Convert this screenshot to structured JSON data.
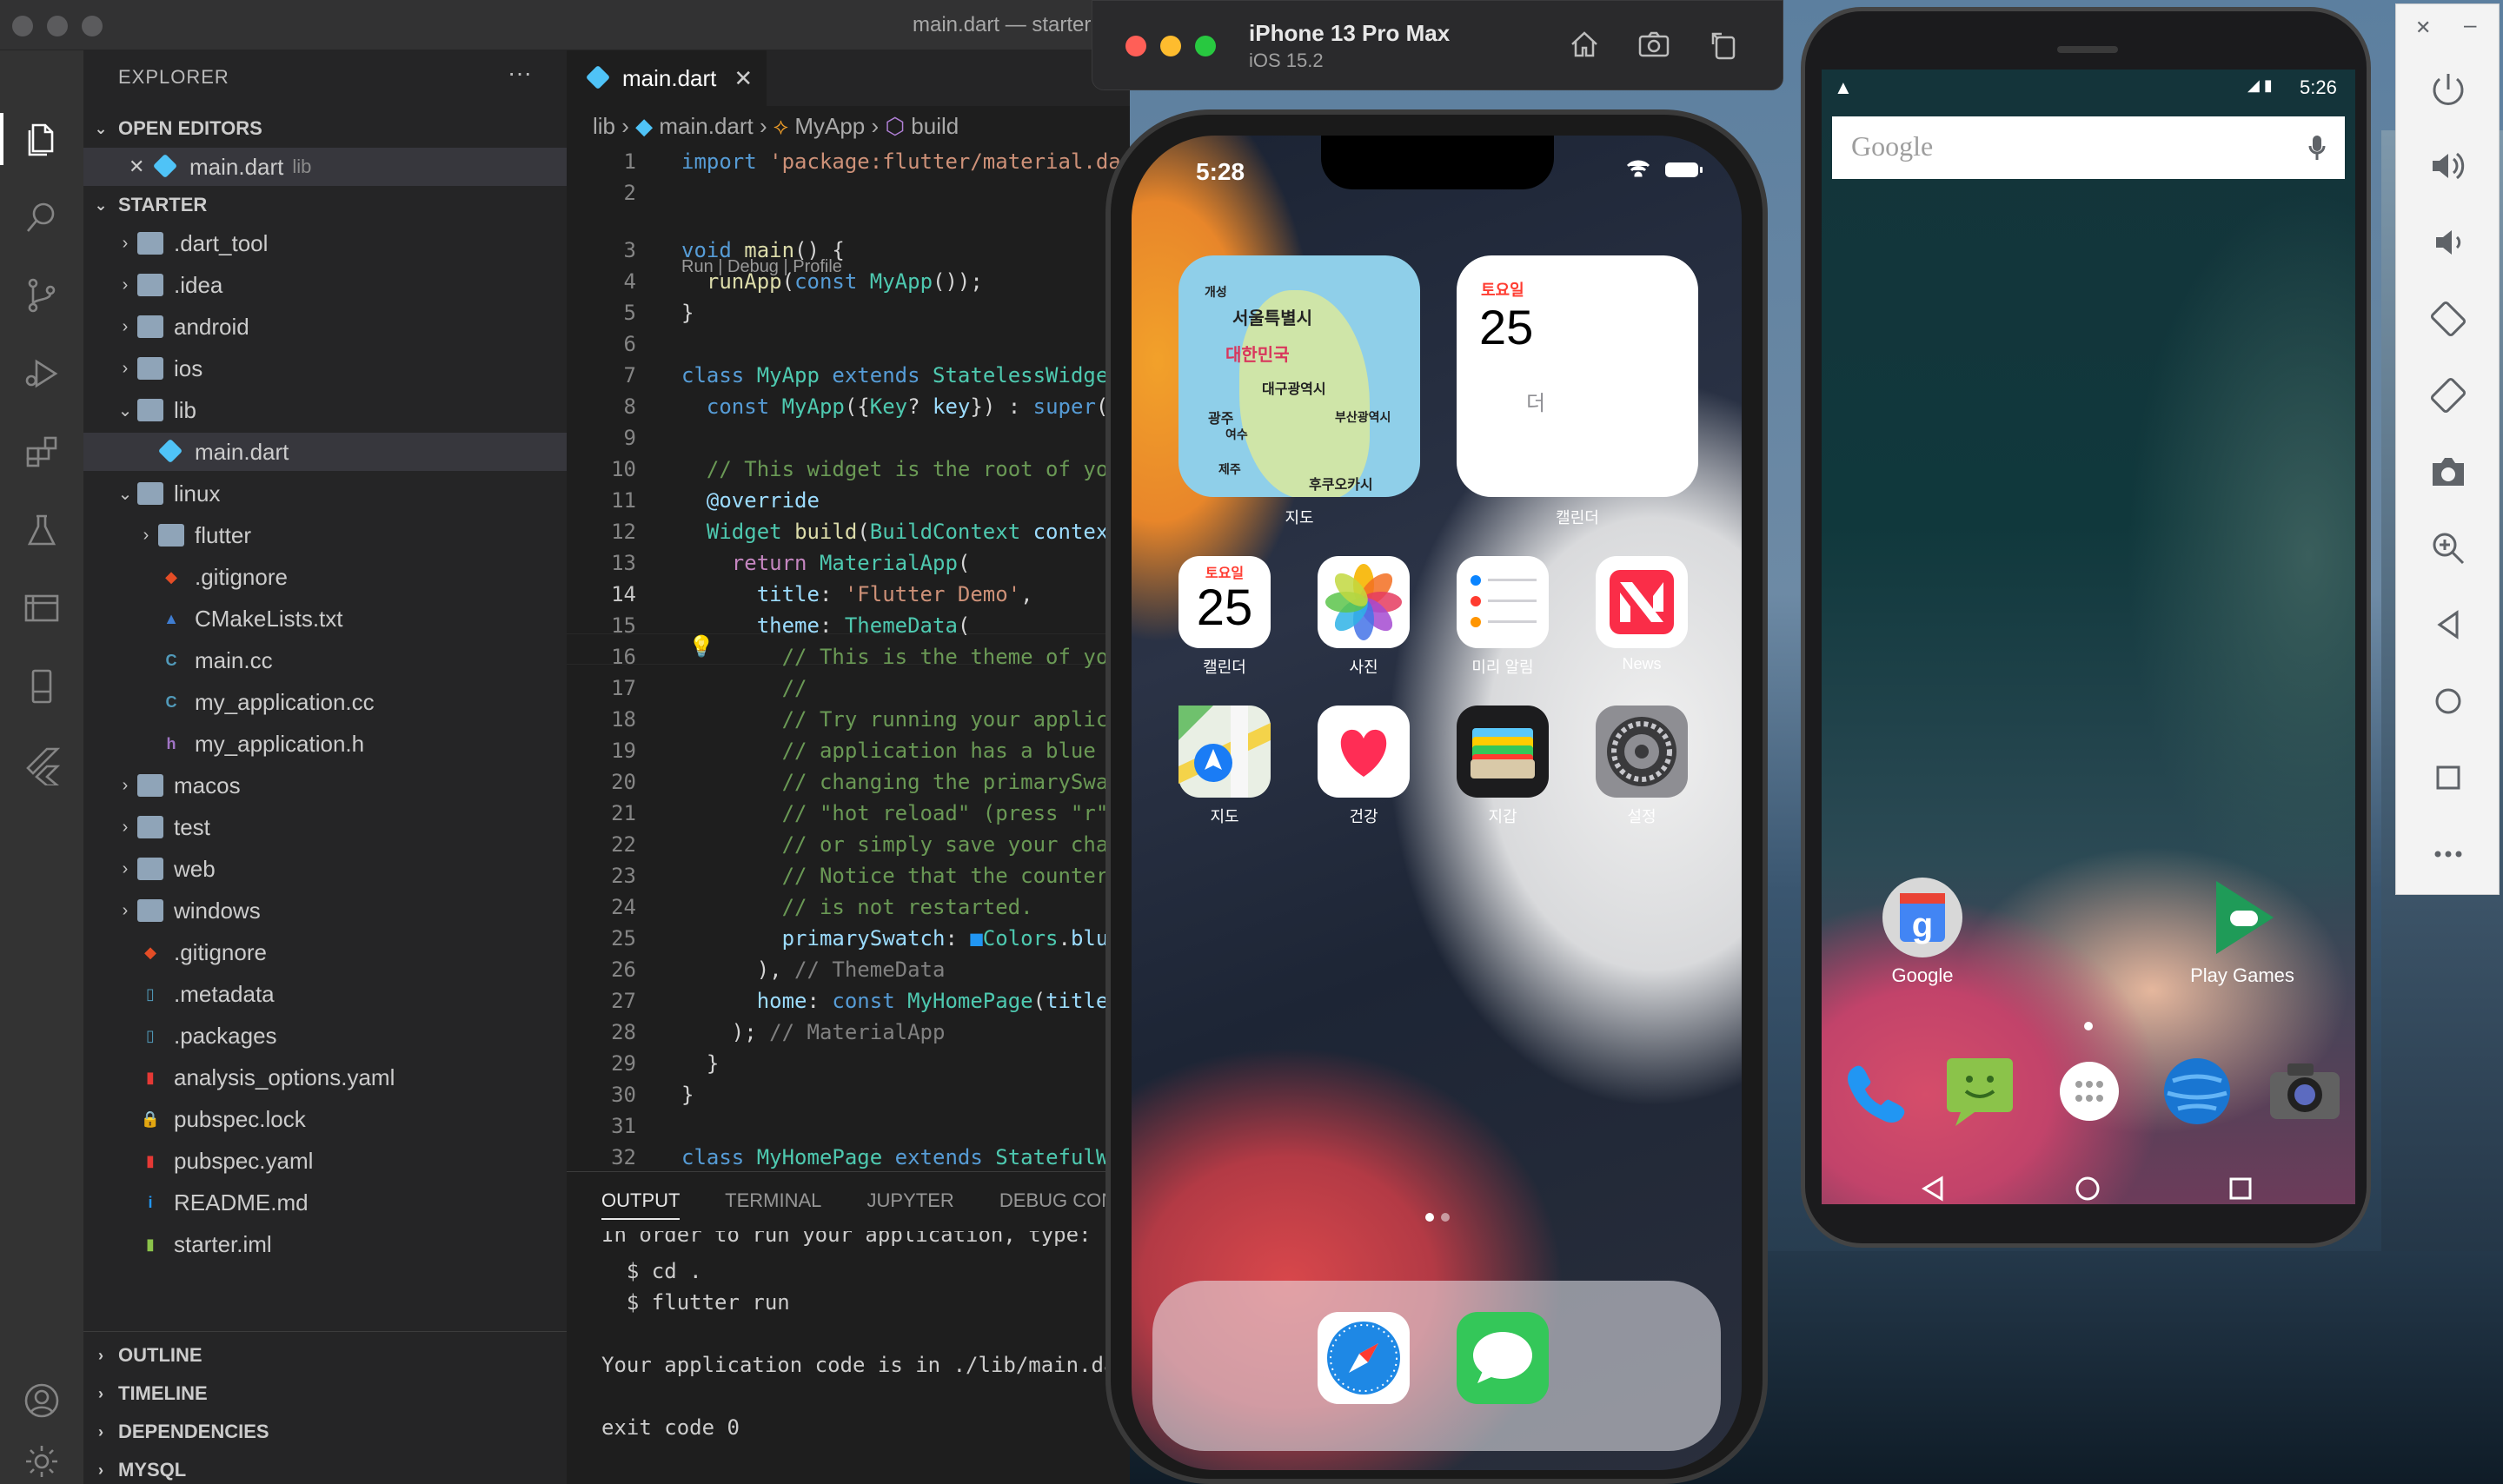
{
  "vscode": {
    "window_title": "main.dart — starter",
    "explorer_title": "EXPLORER",
    "more": "···",
    "open_editors_label": "OPEN EDITORS",
    "open_editor": {
      "name": "main.dart",
      "dir": "lib"
    },
    "project_label": "STARTER",
    "tree": [
      {
        "name": ".dart_tool",
        "kind": "folder",
        "chev": "›"
      },
      {
        "name": ".idea",
        "kind": "folder",
        "chev": "›"
      },
      {
        "name": "android",
        "kind": "folder",
        "chev": "›"
      },
      {
        "name": "ios",
        "kind": "folder",
        "chev": "›"
      },
      {
        "name": "lib",
        "kind": "folder",
        "chev": "⌄"
      },
      {
        "name": "main.dart",
        "kind": "dart"
      },
      {
        "name": "linux",
        "kind": "folder",
        "chev": "⌄"
      },
      {
        "name": "flutter",
        "kind": "folder",
        "chev": "›"
      },
      {
        "name": ".gitignore",
        "kind": "git"
      },
      {
        "name": "CMakeLists.txt",
        "kind": "cmake"
      },
      {
        "name": "main.cc",
        "kind": "cpp"
      },
      {
        "name": "my_application.cc",
        "kind": "cpp"
      },
      {
        "name": "my_application.h",
        "kind": "h"
      },
      {
        "name": "macos",
        "kind": "folder",
        "chev": "›"
      },
      {
        "name": "test",
        "kind": "folder",
        "chev": "›"
      },
      {
        "name": "web",
        "kind": "folder",
        "chev": "›"
      },
      {
        "name": "windows",
        "kind": "folder",
        "chev": "›"
      },
      {
        "name": ".gitignore",
        "kind": "git"
      },
      {
        "name": ".metadata",
        "kind": "file"
      },
      {
        "name": ".packages",
        "kind": "file"
      },
      {
        "name": "analysis_options.yaml",
        "kind": "yaml"
      },
      {
        "name": "pubspec.lock",
        "kind": "lock"
      },
      {
        "name": "pubspec.yaml",
        "kind": "yaml"
      },
      {
        "name": "README.md",
        "kind": "info"
      },
      {
        "name": "starter.iml",
        "kind": "iml"
      }
    ],
    "bottom_sections": [
      "OUTLINE",
      "TIMELINE",
      "DEPENDENCIES",
      "MYSQL"
    ],
    "tab_label": "main.dart",
    "tab_close": "✕",
    "breadcrumb": {
      "dir": "lib",
      "file": "main.dart",
      "cls": "MyApp",
      "method": "build"
    },
    "codelens": "Run | Debug | Profile",
    "line_numbers": [
      "1",
      "2",
      "3",
      "4",
      "5",
      "6",
      "7",
      "8",
      "9",
      "10",
      "11",
      "12",
      "13",
      "14",
      "15",
      "16",
      "17",
      "18",
      "19",
      "20",
      "21",
      "22",
      "23",
      "24",
      "25",
      "26",
      "27",
      "28",
      "29",
      "30",
      "31",
      "32"
    ],
    "panel_tabs": [
      "OUTPUT",
      "TERMINAL",
      "JUPYTER",
      "DEBUG CONSOLE"
    ],
    "terminal": {
      "line0": "In order to run your application, type:",
      "line1": "  $ cd .",
      "line2": "  $ flutter run",
      "line3": "Your application code is in ./lib/main.dart.",
      "line4": "exit code 0"
    }
  },
  "ios_sim": {
    "device_name": "iPhone 13 Pro Max",
    "os": "iOS 15.2",
    "time": "5:28",
    "maps_widget": {
      "caption": "지도",
      "labels": [
        "개성",
        "서울특별시",
        "대한민국",
        "대구광역시",
        "광주",
        "여수",
        "부산광역시",
        "제주",
        "후쿠오카시"
      ]
    },
    "calendar_widget": {
      "weekday": "토요일",
      "day": "25",
      "note": "더",
      "caption": "캘린더"
    },
    "apps_row1": [
      {
        "label": "캘린더",
        "icon": "calendar-icon",
        "weekday": "토요일",
        "day": "25"
      },
      {
        "label": "사진",
        "icon": "photos-icon"
      },
      {
        "label": "미리 알림",
        "icon": "reminders-icon"
      },
      {
        "label": "News",
        "icon": "news-icon"
      }
    ],
    "apps_row2": [
      {
        "label": "지도",
        "icon": "maps-icon"
      },
      {
        "label": "건강",
        "icon": "health-icon"
      },
      {
        "label": "지갑",
        "icon": "wallet-icon"
      },
      {
        "label": "설정",
        "icon": "settings-icon"
      }
    ],
    "dock": [
      "safari-icon",
      "messages-icon"
    ]
  },
  "android_emu": {
    "time": "5:26",
    "search_placeholder": "Google",
    "apps": [
      {
        "label": "Google",
        "icon": "google-icon"
      },
      {
        "label": "Play Games",
        "icon": "play-games-icon"
      }
    ],
    "dock": [
      "phone-icon",
      "messaging-icon",
      "app-drawer-icon",
      "browser-icon",
      "camera-icon"
    ],
    "toolbar_buttons": [
      "close-icon",
      "minimize-icon",
      "power-icon",
      "volume-up-icon",
      "volume-down-icon",
      "rotate-left-icon",
      "rotate-right-icon",
      "camera-icon",
      "zoom-icon",
      "back-icon",
      "home-icon",
      "overview-icon",
      "more-icon"
    ]
  },
  "colors": {
    "vscode_bg": "#1e1e1e",
    "sidebar_bg": "#252526",
    "activity_bg": "#333333",
    "dart_blue": "#4fc3f7"
  }
}
